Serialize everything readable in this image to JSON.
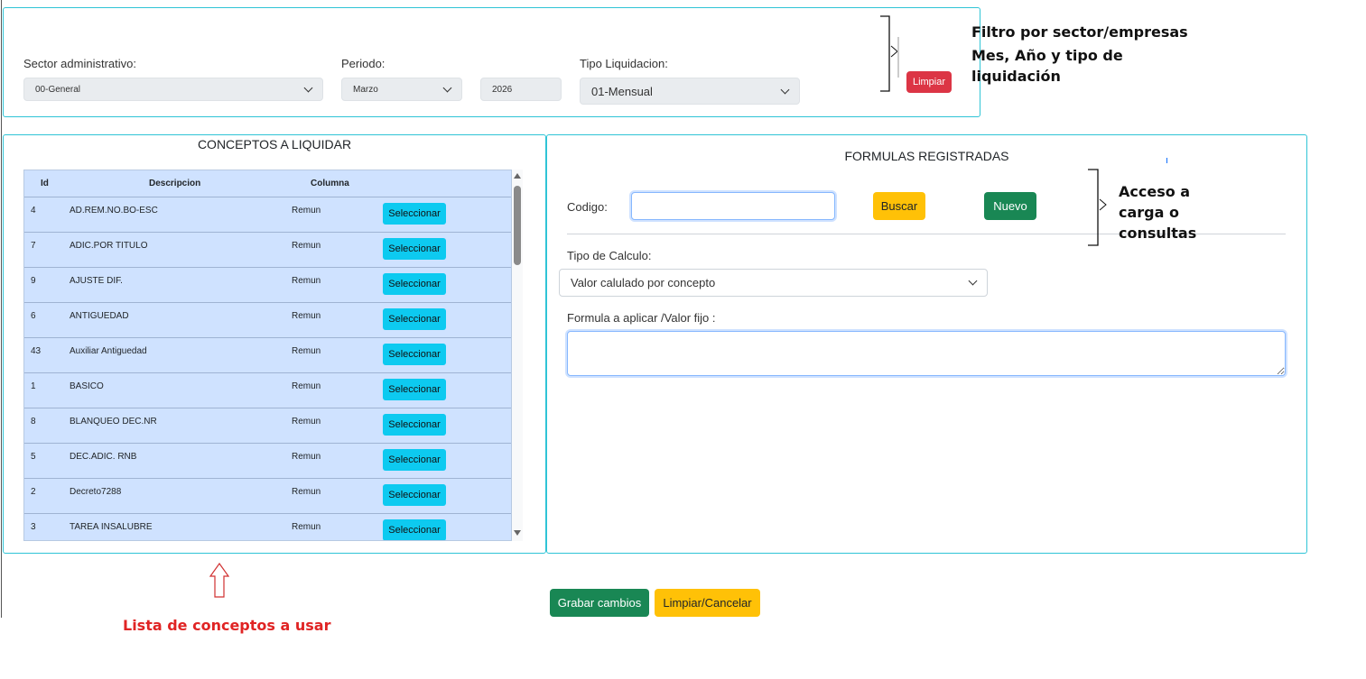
{
  "filters": {
    "sector_label": "Sector administrativo:",
    "sector_value": "00-General",
    "periodo_label": "Periodo:",
    "month_value": "Marzo",
    "year_value": "2026",
    "tipo_label": "Tipo Liquidacion:",
    "tipo_value": "01-Mensual",
    "clear_button": "Limpiar"
  },
  "annotations": {
    "filter_line1": "Filtro por sector/empresas",
    "filter_line2": "Mes, Año y tipo de",
    "filter_line3": "liquidación",
    "access_line1": "Acceso a",
    "access_line2": "carga o",
    "access_line3": "consultas",
    "list_note": "Lista de conceptos a usar"
  },
  "concepts": {
    "title": "CONCEPTOS A LIQUIDAR",
    "headers": {
      "id": "Id",
      "descripcion": "Descripcion",
      "columna": "Columna"
    },
    "select_label": "Seleccionar",
    "rows": [
      {
        "id": "4",
        "descripcion": "AD.REM.NO.BO-ESC",
        "columna": "Remun"
      },
      {
        "id": "7",
        "descripcion": "ADIC.POR TITULO",
        "columna": "Remun"
      },
      {
        "id": "9",
        "descripcion": "AJUSTE DIF.",
        "columna": "Remun"
      },
      {
        "id": "6",
        "descripcion": "ANTIGUEDAD",
        "columna": "Remun"
      },
      {
        "id": "43",
        "descripcion": "Auxiliar Antiguedad",
        "columna": "Remun"
      },
      {
        "id": "1",
        "descripcion": "BASICO",
        "columna": "Remun"
      },
      {
        "id": "8",
        "descripcion": "BLANQUEO DEC.NR",
        "columna": "Remun"
      },
      {
        "id": "5",
        "descripcion": "DEC.ADIC. RNB",
        "columna": "Remun"
      },
      {
        "id": "2",
        "descripcion": "Decreto7288",
        "columna": "Remun"
      },
      {
        "id": "3",
        "descripcion": "TAREA INSALUBRE",
        "columna": "Remun"
      }
    ]
  },
  "formulas": {
    "title": "FORMULAS REGISTRADAS",
    "codigo_label": "Codigo:",
    "codigo_value": "",
    "search_button": "Buscar",
    "new_button": "Nuevo",
    "tipo_calculo_label": "Tipo de Calculo:",
    "tipo_calculo_value": "Valor calulado por concepto",
    "formula_label": "Formula a aplicar /Valor fijo :",
    "formula_value": ""
  },
  "footer": {
    "save_button": "Grabar cambios",
    "cancel_button": "Limpiar/Cancelar"
  },
  "colors": {
    "panel_border": "#2fc4d6",
    "table_bg": "#cfe2ff",
    "select_button": "#0dcaf0",
    "danger": "#dc3545",
    "warning": "#ffc107",
    "success": "#198754",
    "annotation_red": "#e02424"
  }
}
